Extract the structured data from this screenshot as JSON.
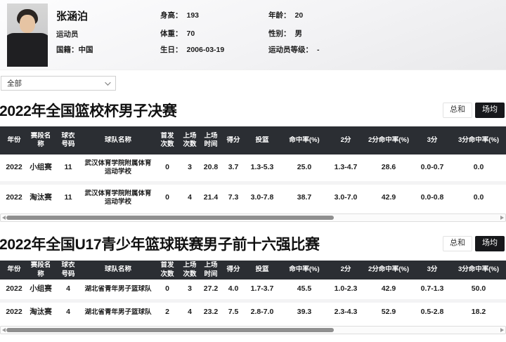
{
  "profile": {
    "name": "张涵泊",
    "role": "运动员",
    "fields": [
      {
        "label": "国籍：",
        "value": "中国"
      },
      {
        "label": "身高：",
        "value": "193"
      },
      {
        "label": "体重：",
        "value": "70"
      },
      {
        "label": "生日：",
        "value": "2006-03-19"
      },
      {
        "label": "年龄：",
        "value": "20"
      },
      {
        "label": "性别：",
        "value": "男"
      },
      {
        "label": "运动员等级：",
        "value": "-"
      }
    ]
  },
  "filter": {
    "selected": "全部"
  },
  "toggle": {
    "sum_label": "总和",
    "avg_label": "场均",
    "active": "场均"
  },
  "columns": [
    "年份",
    "赛段名称",
    "球衣\n号码",
    "球队名称",
    "首发\n次数",
    "上场\n次数",
    "上场\n时间",
    "得分",
    "投篮",
    "命中率(%)",
    "2分",
    "2分命中率(%)",
    "3分",
    "3分命中率(%)"
  ],
  "sections": [
    {
      "title": "2022年全国篮校杯男子决赛",
      "rows": [
        [
          "2022",
          "小组赛",
          "11",
          "武汉体育学院附属体育运动学校",
          "0",
          "3",
          "20.8",
          "3.7",
          "1.3-5.3",
          "25.0",
          "1.3-4.7",
          "28.6",
          "0.0-0.7",
          "0.0"
        ],
        [
          "2022",
          "淘汰赛",
          "11",
          "武汉体育学院附属体育运动学校",
          "0",
          "4",
          "21.4",
          "7.3",
          "3.0-7.8",
          "38.7",
          "3.0-7.0",
          "42.9",
          "0.0-0.8",
          "0.0"
        ]
      ]
    },
    {
      "title": "2022年全国U17青少年篮球联赛男子前十六强比赛",
      "rows": [
        [
          "2022",
          "小组赛",
          "4",
          "湖北省青年男子篮球队",
          "0",
          "3",
          "27.2",
          "4.0",
          "1.7-3.7",
          "45.5",
          "1.0-2.3",
          "42.9",
          "0.7-1.3",
          "50.0"
        ],
        [
          "2022",
          "淘汰赛",
          "4",
          "湖北省青年男子篮球队",
          "2",
          "4",
          "23.2",
          "7.5",
          "2.8-7.0",
          "39.3",
          "2.3-4.3",
          "52.9",
          "0.5-2.8",
          "18.2"
        ]
      ]
    }
  ]
}
